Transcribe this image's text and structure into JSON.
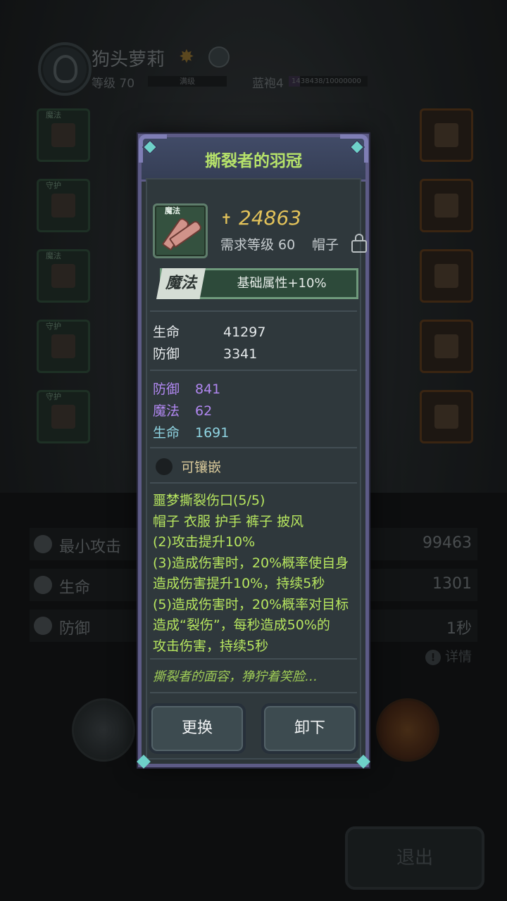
{
  "background": {
    "hero_name": "狗头萝莉",
    "level_label": "等级 70",
    "level_bar_text": "满级",
    "robe_label": "蓝袍4",
    "robe_progress_text": "1438438/10000000",
    "robe_progress_fraction": 0.14,
    "left_slots": [
      {
        "tag": "魔法"
      },
      {
        "tag": "守护"
      },
      {
        "tag": "魔法"
      },
      {
        "tag": "守护"
      },
      {
        "tag": "守护"
      }
    ],
    "stats": [
      {
        "name": "最小攻击",
        "value": "99463"
      },
      {
        "name": "生命",
        "value": "1301"
      },
      {
        "name": "防御",
        "value": "1秒"
      }
    ],
    "detail_label": "详情",
    "exit_label": "退出"
  },
  "popup": {
    "title": "撕裂者的羽冠",
    "item_tag": "魔法",
    "power": "24863",
    "requirement": "需求等级 60",
    "slot_type": "帽子",
    "rarity": {
      "badge": "魔法",
      "text": "基础属性+10%"
    },
    "base_attrs": [
      {
        "name": "生命",
        "value": "41297"
      },
      {
        "name": "防御",
        "value": "3341"
      }
    ],
    "bonus_attrs": [
      {
        "name": "防御",
        "value": "841"
      },
      {
        "name": "魔法",
        "value": "62"
      },
      {
        "name": "生命",
        "value": "1691"
      }
    ],
    "socket_label": "可镶嵌",
    "set_lines": [
      "噩梦撕裂伤口(5/5)",
      "帽子 衣服 护手 裤子 披风",
      "(2)攻击提升10%",
      "(3)造成伤害时，20%概率使自身",
      "造成伤害提升10%，持续5秒",
      "(5)造成伤害时，20%概率对目标",
      "造成“裂伤”，每秒造成50%的",
      "攻击伤害，持续5秒"
    ],
    "flavor": "撕裂者的面容，狰狞着笑脸…",
    "buttons": {
      "replace": "更换",
      "unequip": "卸下"
    }
  },
  "colors": {
    "title": "#b6e26a",
    "power": "#e2c25a",
    "set_text": "#b7e65f",
    "bonus_purple": "#b087f0",
    "bonus_teal": "#8fd4e2",
    "frame": "#5d5b86"
  }
}
